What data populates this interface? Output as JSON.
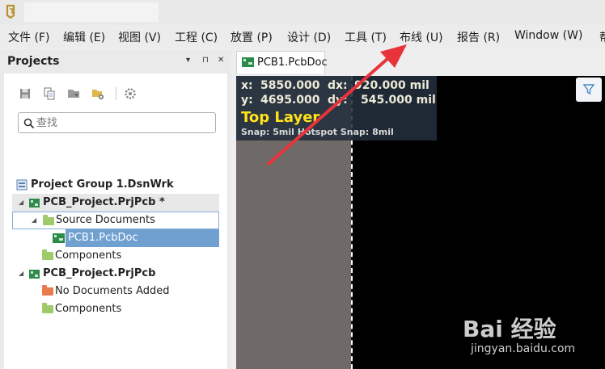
{
  "menu": {
    "items": [
      "文件 (F)",
      "编辑 (E)",
      "视图 (V)",
      "工程 (C)",
      "放置 (P)",
      "设计 (D)",
      "工具 (T)",
      "布线 (U)",
      "报告 (R)",
      "Window (W)",
      "帮"
    ]
  },
  "projects_panel": {
    "title": "Projects",
    "controls": [
      "▾",
      "⊓",
      "✕"
    ],
    "toolbar_icons": [
      "save-icon",
      "copy-icon",
      "compile-icon",
      "folder-settings-icon",
      "gear-icon"
    ],
    "search_placeholder": "查找",
    "tree": [
      {
        "label": "Project Group 1.DsnWrk",
        "bold": true
      },
      {
        "label": "PCB_Project.PrjPcb *",
        "bold": true
      },
      {
        "label": "Source Documents",
        "bold": false
      },
      {
        "label": "PCB1.PcbDoc",
        "bold": false
      },
      {
        "label": "Components",
        "bold": false
      },
      {
        "label": "PCB_Project.PrjPcb",
        "bold": true
      },
      {
        "label": "No Documents Added",
        "bold": false
      },
      {
        "label": "Components",
        "bold": false
      }
    ]
  },
  "document_tab": {
    "label": "PCB1.PcbDoc"
  },
  "canvas": {
    "hud": {
      "x_label": "x:",
      "x_value": "5850.000",
      "dx_label": "dx:",
      "dx_value": "920.000 mil",
      "y_label": "y:",
      "y_value": "4695.000",
      "dy_label": "dy:",
      "dy_value": "545.000 mil",
      "layer": "Top Layer",
      "snap": "Snap: 5mil Hotspot Snap: 8mil"
    },
    "filter_icon": "filter-icon"
  },
  "colors": {
    "arrow": "#e8333a",
    "layer_text": "#ffe21a",
    "selection": "#6fa0d0",
    "canvas": "#000000",
    "gray_region": "#6f6a68"
  },
  "watermark": {
    "brand": "Bai 经验",
    "url": "jingyan.baidu.com"
  }
}
